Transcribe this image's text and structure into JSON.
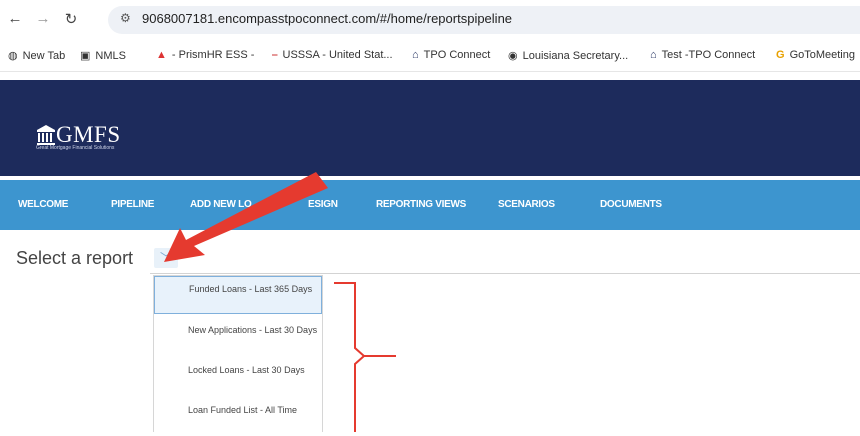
{
  "browser": {
    "url": "9068007181.encompasstpoconnect.com/#/home/reportspipeline",
    "bookmarks": [
      {
        "label": "New Tab",
        "icon": "globe-icon"
      },
      {
        "label": "NMLS",
        "icon": "nmls-icon"
      },
      {
        "label": "- PrismHR ESS -",
        "icon": "prismhr-icon"
      },
      {
        "label": "USSSA - United Stat...",
        "icon": "usssa-icon"
      },
      {
        "label": "TPO Connect",
        "icon": "building-icon"
      },
      {
        "label": "Louisiana Secretary...",
        "icon": "seal-icon"
      },
      {
        "label": "Test -TPO Connect",
        "icon": "building-icon"
      },
      {
        "label": "GoToMeeting",
        "icon": "goto-icon"
      }
    ]
  },
  "logo": {
    "text": "GMFS",
    "subtitle": "Great Mortgage Financial Solutions"
  },
  "nav": {
    "items": [
      "WELCOME",
      "PIPELINE",
      "ADD NEW LO",
      "ESIGN",
      "REPORTING VIEWS",
      "SCENARIOS",
      "DOCUMENTS"
    ]
  },
  "report": {
    "label": "Select a report",
    "options": [
      "Funded Loans - Last 365 Days",
      "New Applications - Last 30 Days",
      "Locked Loans - Last 30 Days",
      "Loan Funded List - All Time"
    ],
    "selected_index": 0
  },
  "colors": {
    "banner": "#1d2b5c",
    "navbar": "#3d95cf",
    "annotation": "#e53a2f"
  }
}
